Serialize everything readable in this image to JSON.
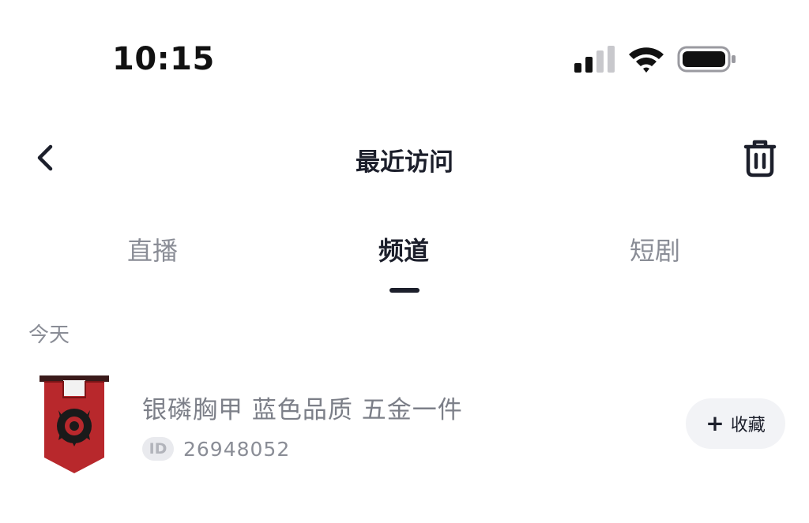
{
  "status_bar": {
    "time": "10:15",
    "icons": [
      "cellular-signal-icon",
      "wifi-icon",
      "battery-icon"
    ]
  },
  "nav": {
    "title": "最近访问",
    "back_icon": "chevron-left-icon",
    "delete_icon": "trash-icon"
  },
  "tabs": [
    {
      "label": "直播",
      "active": false
    },
    {
      "label": "频道",
      "active": true
    },
    {
      "label": "短剧",
      "active": false
    }
  ],
  "section": {
    "label": "今天"
  },
  "channels": [
    {
      "name": "银磷胸甲 蓝色品质 五金一件",
      "id_badge": "ID",
      "id": "26948052",
      "favorite_label": "收藏",
      "favorite_icon": "plus-icon",
      "thumbnail": "horde-banner-image"
    }
  ],
  "colors": {
    "primary_text": "#1c1f2b",
    "secondary_text": "#8a8d96",
    "banner_red": "#b8282c",
    "button_bg": "#f2f3f6"
  }
}
